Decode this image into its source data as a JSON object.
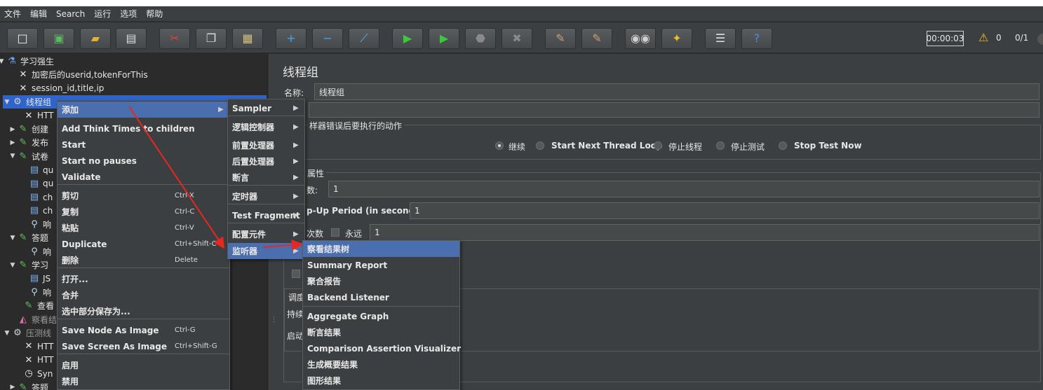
{
  "menubar": [
    "文件",
    "编辑",
    "Search",
    "运行",
    "选项",
    "帮助"
  ],
  "toolbar": {
    "buttons": [
      {
        "name": "new-button",
        "icon": "□",
        "color": "#f0f0f0"
      },
      {
        "name": "templates-button",
        "icon": "▣",
        "color": "#5fb85f"
      },
      {
        "name": "open-button",
        "icon": "▰",
        "color": "#e8b030"
      },
      {
        "name": "save-button",
        "icon": "▤",
        "color": "#dcdcdc"
      },
      {
        "name": "cut-button",
        "icon": "✂",
        "color": "#e04040"
      },
      {
        "name": "copy-button",
        "icon": "❐",
        "color": "#e0e0e0"
      },
      {
        "name": "paste-button",
        "icon": "▦",
        "color": "#d8c080"
      },
      {
        "name": "expand-button",
        "icon": "+",
        "color": "#4aa0f0"
      },
      {
        "name": "collapse-button",
        "icon": "−",
        "color": "#4aa0f0"
      },
      {
        "name": "toggle-button",
        "icon": "⟋",
        "color": "#60b0e0"
      },
      {
        "name": "start-button",
        "icon": "▶",
        "color": "#3cc83c"
      },
      {
        "name": "start-no-pauses-button",
        "icon": "▶",
        "color": "#3cc83c"
      },
      {
        "name": "stop-button",
        "icon": "⬣",
        "color": "#8a8a8a"
      },
      {
        "name": "shutdown-button",
        "icon": "✖",
        "color": "#8a8a8a"
      },
      {
        "name": "clear-button",
        "icon": "✎",
        "color": "#c8a070"
      },
      {
        "name": "clear-all-button",
        "icon": "✎",
        "color": "#c8a070"
      },
      {
        "name": "search-button",
        "icon": "◉◉",
        "color": "#d0d0d0"
      },
      {
        "name": "reset-search-button",
        "icon": "✦",
        "color": "#f0c020"
      },
      {
        "name": "function-helper-button",
        "icon": "☰",
        "color": "#e0e0e0"
      },
      {
        "name": "help-button",
        "icon": "?",
        "color": "#4a90e0"
      }
    ],
    "timer": "00:00:03",
    "warning_count": "0",
    "thread_count": "0/1"
  },
  "tree": [
    {
      "label": "学习强生",
      "icon": "flask-icon",
      "glyph": "⚗",
      "twisty": "▼"
    },
    {
      "label": "加密后的userid,tokenForThis",
      "icon": "tools-icon",
      "glyph": "✕",
      "twisty": ""
    },
    {
      "label": "session_id,title,ip",
      "icon": "tools-icon",
      "glyph": "✕",
      "twisty": ""
    },
    {
      "label": "线程组",
      "icon": "gear-icon",
      "glyph": "⚙",
      "twisty": "▼"
    },
    {
      "label": "HTT",
      "icon": "tools-icon",
      "glyph": "✕",
      "twisty": ""
    },
    {
      "label": "创建",
      "icon": "pipette-icon",
      "glyph": "✎",
      "twisty": "▶"
    },
    {
      "label": "发布",
      "icon": "pipette-icon",
      "glyph": "✎",
      "twisty": "▶"
    },
    {
      "label": "试卷",
      "icon": "pipette-icon",
      "glyph": "✎",
      "twisty": "▼"
    },
    {
      "label": "qu",
      "icon": "doc-icon",
      "glyph": "▤",
      "twisty": ""
    },
    {
      "label": "qu",
      "icon": "doc-icon",
      "glyph": "▤",
      "twisty": ""
    },
    {
      "label": "ch",
      "icon": "doc-icon",
      "glyph": "▤",
      "twisty": ""
    },
    {
      "label": "ch",
      "icon": "doc-icon",
      "glyph": "▤",
      "twisty": ""
    },
    {
      "label": "响",
      "icon": "magnifier-icon",
      "glyph": "⚲",
      "twisty": ""
    },
    {
      "label": "答题",
      "icon": "pipette-icon",
      "glyph": "✎",
      "twisty": "▼"
    },
    {
      "label": "响",
      "icon": "magnifier-icon",
      "glyph": "⚲",
      "twisty": ""
    },
    {
      "label": "学习",
      "icon": "pipette-icon",
      "glyph": "✎",
      "twisty": "▼"
    },
    {
      "label": "JS",
      "icon": "doc-icon",
      "glyph": "▤",
      "twisty": ""
    },
    {
      "label": "响",
      "icon": "magnifier-icon",
      "glyph": "⚲",
      "twisty": ""
    },
    {
      "label": "查看",
      "icon": "pipette-icon",
      "glyph": "✎",
      "twisty": ""
    },
    {
      "label": "察看结",
      "icon": "chart-icon",
      "glyph": "◭",
      "twisty": ""
    },
    {
      "label": "压测线",
      "icon": "gear-icon",
      "glyph": "⚙",
      "twisty": "▼"
    },
    {
      "label": "HTT",
      "icon": "tools-icon",
      "glyph": "✕",
      "twisty": ""
    },
    {
      "label": "HTT",
      "icon": "tools-icon",
      "glyph": "✕",
      "twisty": ""
    },
    {
      "label": "Syn",
      "icon": "timer-icon",
      "glyph": "◷",
      "twisty": ""
    },
    {
      "label": "答题",
      "icon": "pipette-icon",
      "glyph": "✎",
      "twisty": "▶"
    }
  ],
  "panel": {
    "title": "线程组",
    "name_label": "名称:",
    "name_value": "线程组",
    "on_error_label": "样器错误后要执行的动作",
    "actions": [
      "继续",
      "Start Next Thread Loop",
      "停止线程",
      "停止测试",
      "Stop Test Now"
    ],
    "properties_label": "属性",
    "threads_label": "数:",
    "threads_value": "1",
    "rampup_label": "p-Up Period (in seconds):",
    "rampup_value": "1",
    "loop_label": "次数",
    "forever_label": "永远",
    "loop_value": "1",
    "scheduler_label": "调度",
    "duration_label": "持续",
    "startup_label": "启动"
  },
  "context_menu": {
    "items": [
      {
        "label": "添加",
        "shortcut": "",
        "submenu": true
      },
      {
        "label": "Add Think Times to children",
        "shortcut": ""
      },
      {
        "label": "Start",
        "shortcut": ""
      },
      {
        "label": "Start no pauses",
        "shortcut": ""
      },
      {
        "label": "Validate",
        "shortcut": ""
      },
      {
        "label": "剪切",
        "shortcut": "Ctrl-X"
      },
      {
        "label": "复制",
        "shortcut": "Ctrl-C"
      },
      {
        "label": "粘贴",
        "shortcut": "Ctrl-V"
      },
      {
        "label": "Duplicate",
        "shortcut": "Ctrl+Shift-C"
      },
      {
        "label": "删除",
        "shortcut": "Delete"
      },
      {
        "label": "打开...",
        "shortcut": ""
      },
      {
        "label": "合并",
        "shortcut": ""
      },
      {
        "label": "选中部分保存为...",
        "shortcut": ""
      },
      {
        "label": "Save Node As Image",
        "shortcut": "Ctrl-G"
      },
      {
        "label": "Save Screen As Image",
        "shortcut": "Ctrl+Shift-G"
      },
      {
        "label": "启用",
        "shortcut": ""
      },
      {
        "label": "禁用",
        "shortcut": ""
      }
    ]
  },
  "add_submenu": {
    "items": [
      "Sampler",
      "逻辑控制器",
      "前置处理器",
      "后置处理器",
      "断言",
      "定时器",
      "Test Fragment",
      "配置元件",
      "监听器"
    ]
  },
  "listener_submenu": {
    "items": [
      "察看结果树",
      "Summary Report",
      "聚合报告",
      "Backend Listener",
      "Aggregate Graph",
      "断言结果",
      "Comparison Assertion Visualizer",
      "生成概要结果",
      "图形结果"
    ]
  },
  "colors": {
    "background": "#3c3f41",
    "selection": "#4b6eaf",
    "annotation_arrow": "#e8281e"
  }
}
